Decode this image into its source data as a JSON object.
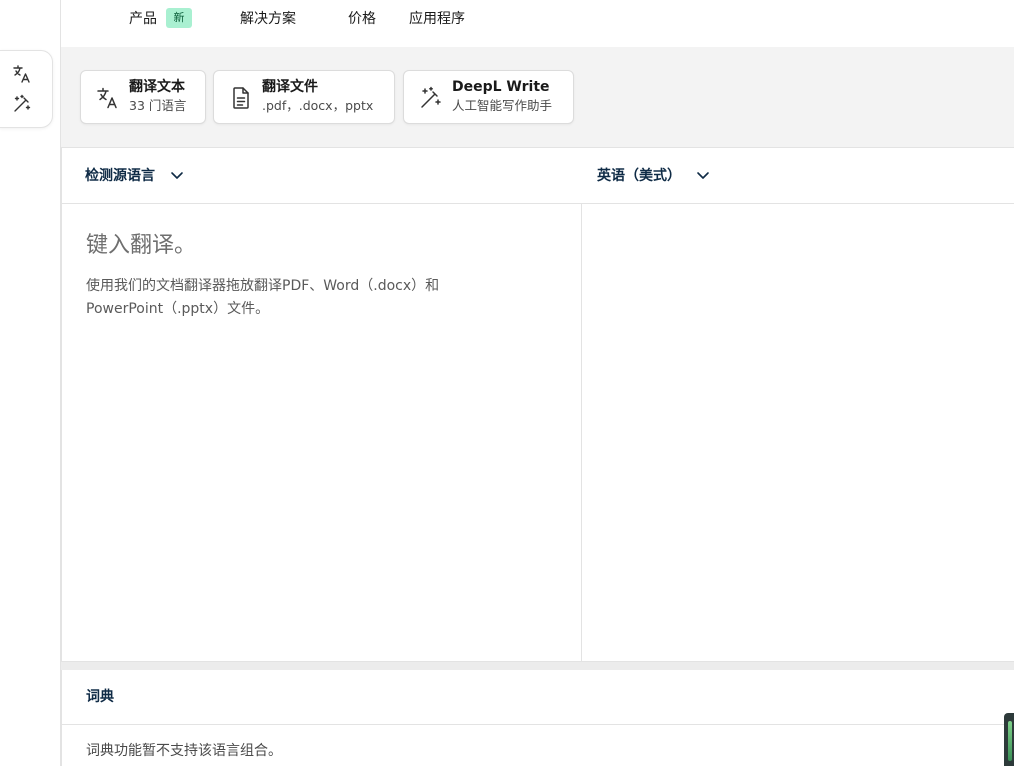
{
  "nav": {
    "products": "产品",
    "new_badge": "新",
    "solutions": "解决方案",
    "pricing": "价格",
    "apps": "应用程序"
  },
  "rail": {
    "icons": [
      "translate-icon",
      "magic-wand-icon"
    ]
  },
  "modes": [
    {
      "title": "翻译文本",
      "subtitle": "33 门语言",
      "icon": "translate-icon"
    },
    {
      "title": "翻译文件",
      "subtitle": ".pdf，.docx，pptx",
      "icon": "document-icon"
    },
    {
      "title": "DeepL Write",
      "subtitle": "人工智能写作助手",
      "icon": "magic-wand-icon"
    }
  ],
  "translator": {
    "source_lang": "检测源语言",
    "target_lang": "英语（美式）",
    "placeholder": "键入翻译。",
    "hint": "使用我们的文档翻译器拖放翻译PDF、Word（.docx）和PowerPoint（.pptx）文件。"
  },
  "dictionary": {
    "title": "词典",
    "message": "词典功能暂不支持该语言组合。"
  },
  "colors": {
    "accent_dark": "#0f2b46",
    "badge_bg": "#a9f0d1",
    "band_bg": "#f3f3f3"
  }
}
